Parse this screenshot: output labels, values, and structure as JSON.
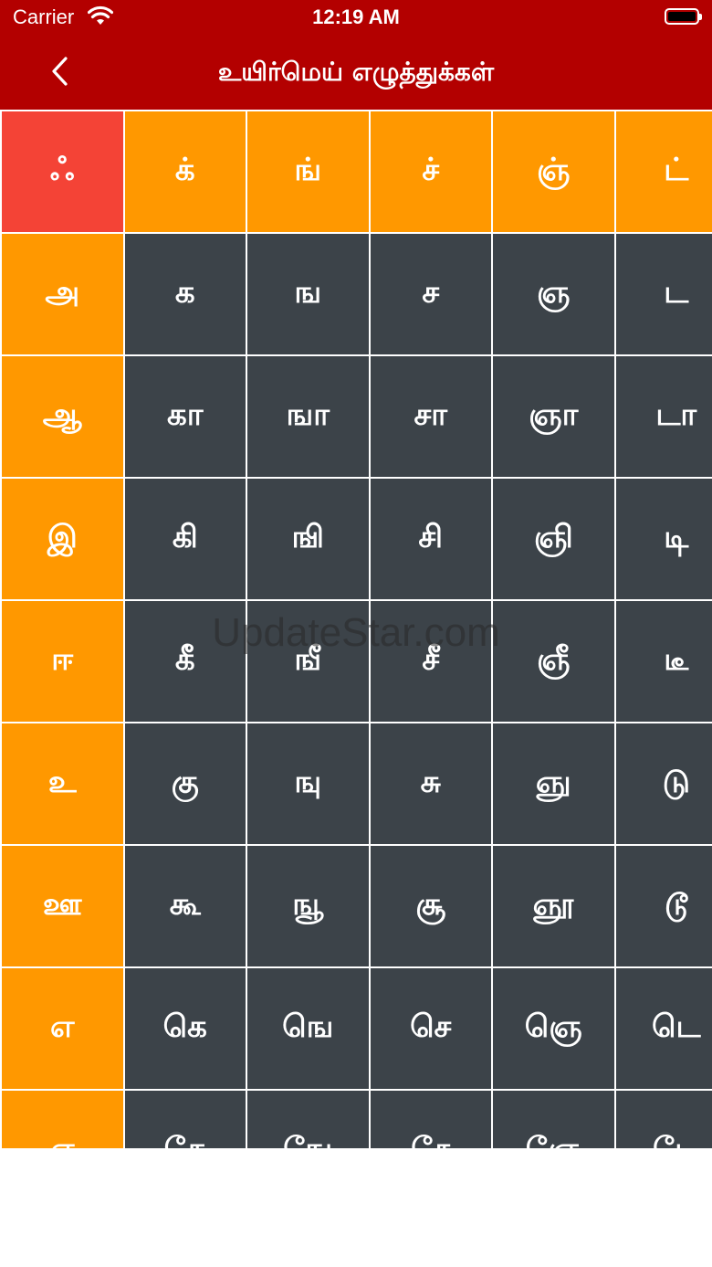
{
  "status_bar": {
    "carrier": "Carrier",
    "time": "12:19 AM"
  },
  "header": {
    "title": "உயிர்மெய் எழுத்துக்கள்"
  },
  "watermark": "UpdateStar.com",
  "grid": {
    "corner": "ஃ",
    "consonants": [
      "க்",
      "ங்",
      "ச்",
      "ஞ்",
      "ட்"
    ],
    "rows": [
      {
        "vowel": "அ",
        "cells": [
          "க",
          "ங",
          "ச",
          "ஞ",
          "ட"
        ]
      },
      {
        "vowel": "ஆ",
        "cells": [
          "கா",
          "ஙா",
          "சா",
          "ஞா",
          "டா"
        ]
      },
      {
        "vowel": "இ",
        "cells": [
          "கி",
          "ஙி",
          "சி",
          "ஞி",
          "டி"
        ]
      },
      {
        "vowel": "ஈ",
        "cells": [
          "கீ",
          "ஙீ",
          "சீ",
          "ஞீ",
          "டீ"
        ]
      },
      {
        "vowel": "உ",
        "cells": [
          "கு",
          "ஙு",
          "சு",
          "ஞு",
          "டு"
        ]
      },
      {
        "vowel": "ஊ",
        "cells": [
          "கூ",
          "ஙூ",
          "சூ",
          "ஞூ",
          "டூ"
        ]
      },
      {
        "vowel": "எ",
        "cells": [
          "கெ",
          "ஙெ",
          "செ",
          "ஞெ",
          "டெ"
        ]
      },
      {
        "vowel": "ஏ",
        "cells": [
          "கே",
          "ஙே",
          "சே",
          "ஞே",
          "டே"
        ]
      }
    ]
  },
  "colors": {
    "header_bg": "#b30000",
    "corner": "#f44336",
    "heading_cell": "#ff9800",
    "letter_cell": "#3c4349"
  }
}
